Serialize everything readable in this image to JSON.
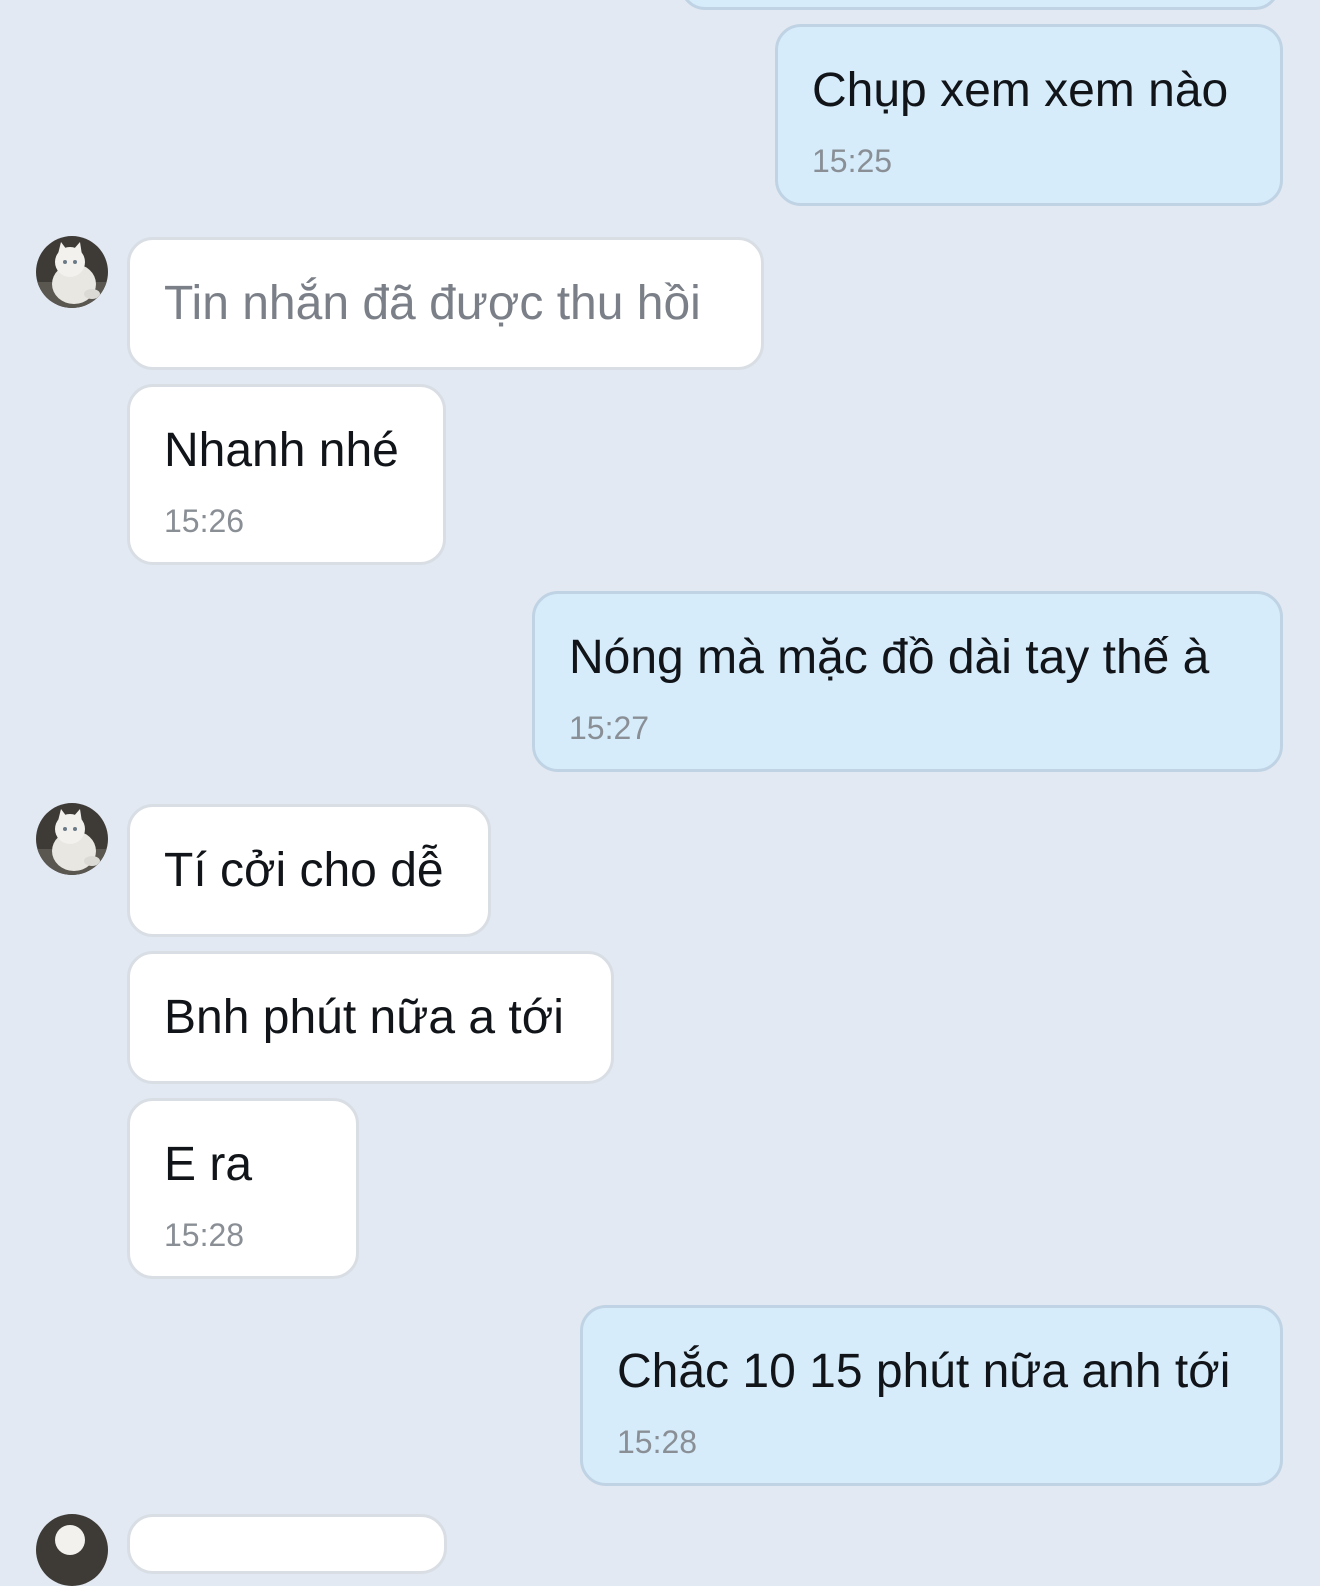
{
  "conversation": {
    "messages": [
      {
        "direction": "outgoing",
        "text": "Chụp xem xem nào",
        "time": "15:25"
      },
      {
        "direction": "incoming",
        "text": "Tin nhắn đã được thu hồi",
        "recalled": true
      },
      {
        "direction": "incoming",
        "text": "Nhanh nhé",
        "time": "15:26"
      },
      {
        "direction": "outgoing",
        "text": "Nóng mà mặc đồ dài tay thế à",
        "time": "15:27"
      },
      {
        "direction": "incoming",
        "text": "Tí cởi cho dễ"
      },
      {
        "direction": "incoming",
        "text": "Bnh phút nữa a tới"
      },
      {
        "direction": "incoming",
        "text": "E ra",
        "time": "15:28"
      },
      {
        "direction": "outgoing",
        "text": "Chắc 10 15 phút nữa anh tới",
        "time": "15:28"
      }
    ],
    "contact_avatar": {
      "icon": "cat-avatar-icon"
    }
  },
  "colors": {
    "background": "#e2e9f2",
    "outgoing_bubble": "#d6ecfb",
    "incoming_bubble": "#ffffff",
    "timestamp": "#8a8f96"
  }
}
